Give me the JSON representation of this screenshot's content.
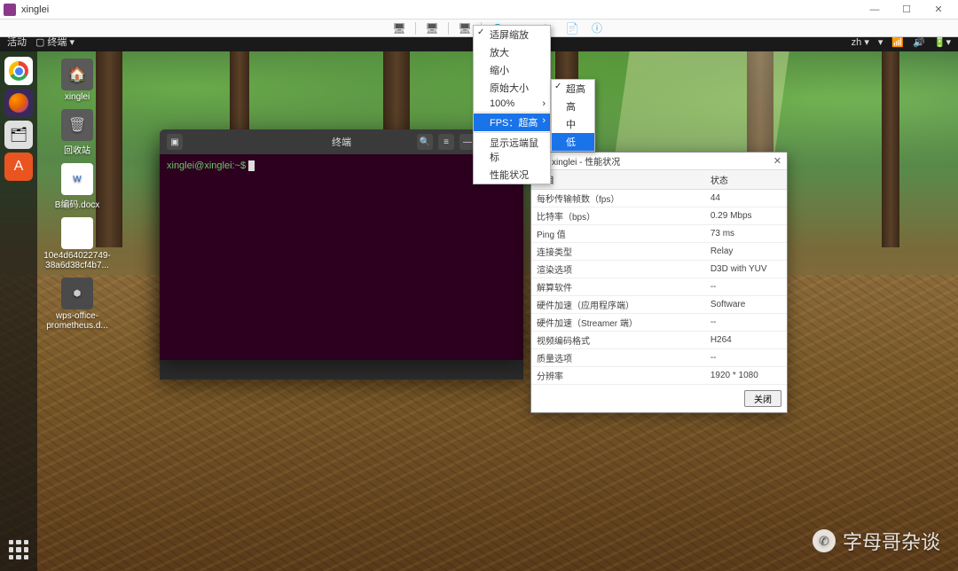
{
  "window": {
    "title": "xinglei"
  },
  "ubuntuBar": {
    "activities": "活动",
    "terminal": "终端 ▾",
    "lang": "zh ▾"
  },
  "desktop": {
    "home": "xinglei",
    "trash": "回收站",
    "doc1": "B编码.docx",
    "img1": "10e4d64022749-38a6d38cf4b7...",
    "doc2": "wps-office-prometheus.d..."
  },
  "terminal": {
    "title": "终端",
    "prompt": "xinglei@xinglei:~$ "
  },
  "menu": {
    "fullscreen": "适屏缩放",
    "zoomIn": "放大",
    "zoomOut": "缩小",
    "original": "原始大小",
    "pct": "100%",
    "fps": "FPS：超高",
    "showCursor": "显示远端鼠标",
    "perf": "性能状况"
  },
  "submenu": {
    "ultra": "超高",
    "high": "高",
    "mid": "中",
    "low": "低"
  },
  "perf": {
    "title": "xinglei - 性能状况",
    "colItem": "项目",
    "colStatus": "状态",
    "rows": [
      {
        "k": "每秒传输帧数（fps）",
        "v": "44"
      },
      {
        "k": "比特率（bps）",
        "v": "0.29 Mbps"
      },
      {
        "k": "Ping 值",
        "v": "73 ms"
      },
      {
        "k": "连接类型",
        "v": "Relay"
      },
      {
        "k": "渲染选项",
        "v": "D3D with YUV"
      },
      {
        "k": "解算软件",
        "v": "--"
      },
      {
        "k": "硬件加速（应用程序端）",
        "v": "Software"
      },
      {
        "k": "硬件加速（Streamer 端）",
        "v": "--"
      },
      {
        "k": "视频编码格式",
        "v": "H264"
      },
      {
        "k": "质量选项",
        "v": "--"
      },
      {
        "k": "分辨率",
        "v": "1920 * 1080"
      }
    ],
    "close": "关闭"
  },
  "watermark": "字母哥杂谈"
}
